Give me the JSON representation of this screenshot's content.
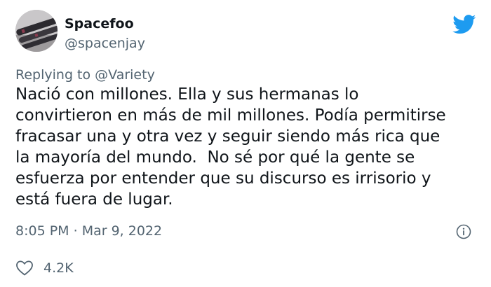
{
  "author": {
    "display_name": "Spacefoo",
    "handle": "@spacenjay",
    "avatar_icon": "avatar-photo"
  },
  "platform_icon": "twitter-bird-icon",
  "reply": {
    "prefix": "Replying to",
    "mention": "@Variety"
  },
  "tweet": {
    "lines": [
      "Nació con millones. Ella y sus hermanas lo",
      "convirtieron en más de mil millones. Podía permitirse",
      "fracasar una y otra vez y seguir siendo más rica que",
      "la mayoría del mundo.  No sé por qué la gente se",
      "esfuerza por entender que su discurso es irrisorio y",
      "está fuera de lugar."
    ]
  },
  "meta": {
    "time": "8:05 PM",
    "separator": "·",
    "date": "Mar 9, 2022"
  },
  "engagement": {
    "likes": "4.2K"
  },
  "colors": {
    "text": "#0f1419",
    "secondary": "#536471",
    "twitter_blue": "#1d9bf0"
  }
}
